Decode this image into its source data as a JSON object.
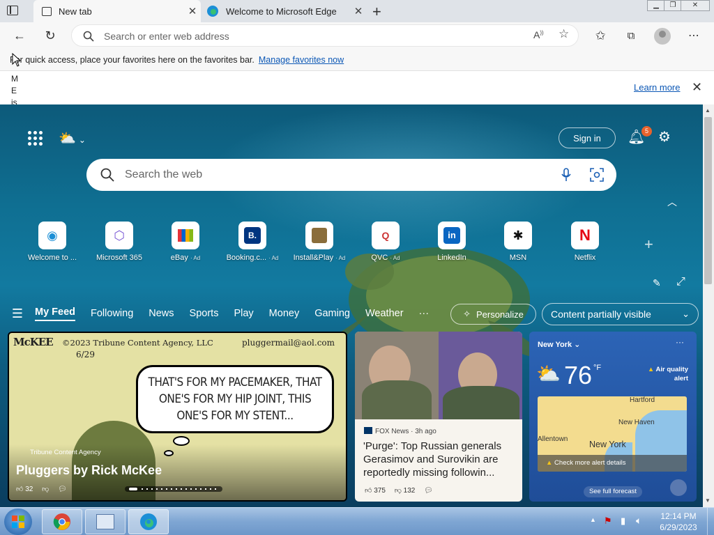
{
  "tabs": [
    {
      "title": "New tab"
    },
    {
      "title": "Welcome to Microsoft Edge"
    }
  ],
  "toolbar": {
    "address_placeholder": "Search or enter web address"
  },
  "favbar": {
    "text": "For quick access, place your favorites here on the favorites bar.",
    "link": "Manage favorites now"
  },
  "infobar": {
    "vertical_text": "M E is",
    "learn_more": "Learn more"
  },
  "ntp": {
    "sign_in": "Sign in",
    "notification_count": "5",
    "search_placeholder": "Search the web",
    "quick_links": [
      {
        "label": "Welcome to ...",
        "ad": ""
      },
      {
        "label": "Microsoft 365",
        "ad": ""
      },
      {
        "label": "eBay",
        "ad": "Ad"
      },
      {
        "label": "Booking.c...",
        "ad": "Ad"
      },
      {
        "label": "Install&Play",
        "ad": "Ad"
      },
      {
        "label": "QVC",
        "ad": "Ad"
      },
      {
        "label": "LinkedIn",
        "ad": ""
      },
      {
        "label": "MSN",
        "ad": ""
      },
      {
        "label": "Netflix",
        "ad": ""
      }
    ],
    "feed_nav": [
      "My Feed",
      "Following",
      "News",
      "Sports",
      "Play",
      "Money",
      "Gaming",
      "Weather",
      "···"
    ],
    "personalize": "Personalize",
    "content_visibility": "Content partially visible"
  },
  "comic_card": {
    "header_left": "©2023 Tribune Content Agency, LLC",
    "date": "6/29",
    "email": "pluggermail@aol.com",
    "speech": "THAT'S FOR MY PACEMAKER, THAT ONE'S FOR MY HIP JOINT, THIS ONE'S FOR MY STENT...",
    "source": "Tribune Content Agency",
    "title": "Pluggers by Rick McKee",
    "likes": "32"
  },
  "news_card": {
    "source": "FOX News · 3h ago",
    "headline": "'Purge': Top Russian generals Gerasimov and Surovikin are reportedly missing followin...",
    "likes": "375",
    "dislikes": "132"
  },
  "weather_card": {
    "location": "New York",
    "temperature": "76",
    "unit": "°F",
    "alert": "Air quality alert",
    "map_labels": [
      "Hartford",
      "New Haven",
      "Allentown",
      "New York"
    ],
    "alert_details": "Check more alert details",
    "forecast_link": "See full forecast"
  },
  "taskbar": {
    "time": "12:14 PM",
    "date": "6/29/2023"
  }
}
